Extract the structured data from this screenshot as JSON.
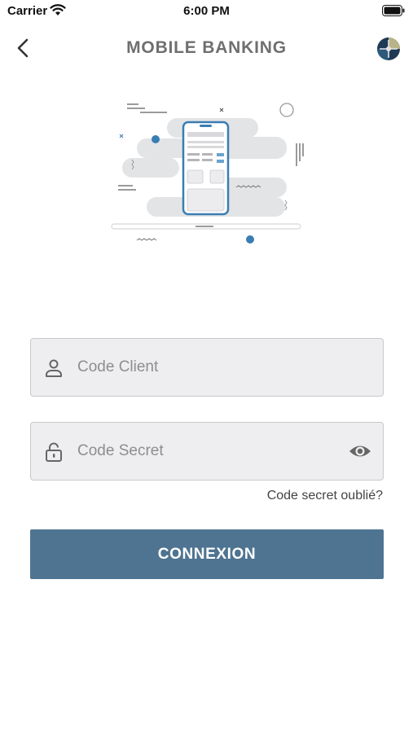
{
  "status_bar": {
    "carrier": "Carrier",
    "time": "6:00 PM"
  },
  "header": {
    "title": "MOBILE BANKING",
    "back_icon": "chevron-left-icon",
    "globe_icon": "language-globe-icon"
  },
  "form": {
    "client_code": {
      "placeholder": "Code Client",
      "value": "",
      "icon": "user-icon"
    },
    "secret_code": {
      "placeholder": "Code Secret",
      "value": "",
      "icon": "lock-open-icon",
      "toggle_icon": "eye-icon"
    },
    "forgot_label": "Code secret oublié?",
    "submit_label": "CONNEXION"
  },
  "colors": {
    "primary": "#4e7491",
    "title": "#6f6f6f",
    "field_background": "#eeeef0",
    "illustration_accent": "#3a7db3"
  }
}
